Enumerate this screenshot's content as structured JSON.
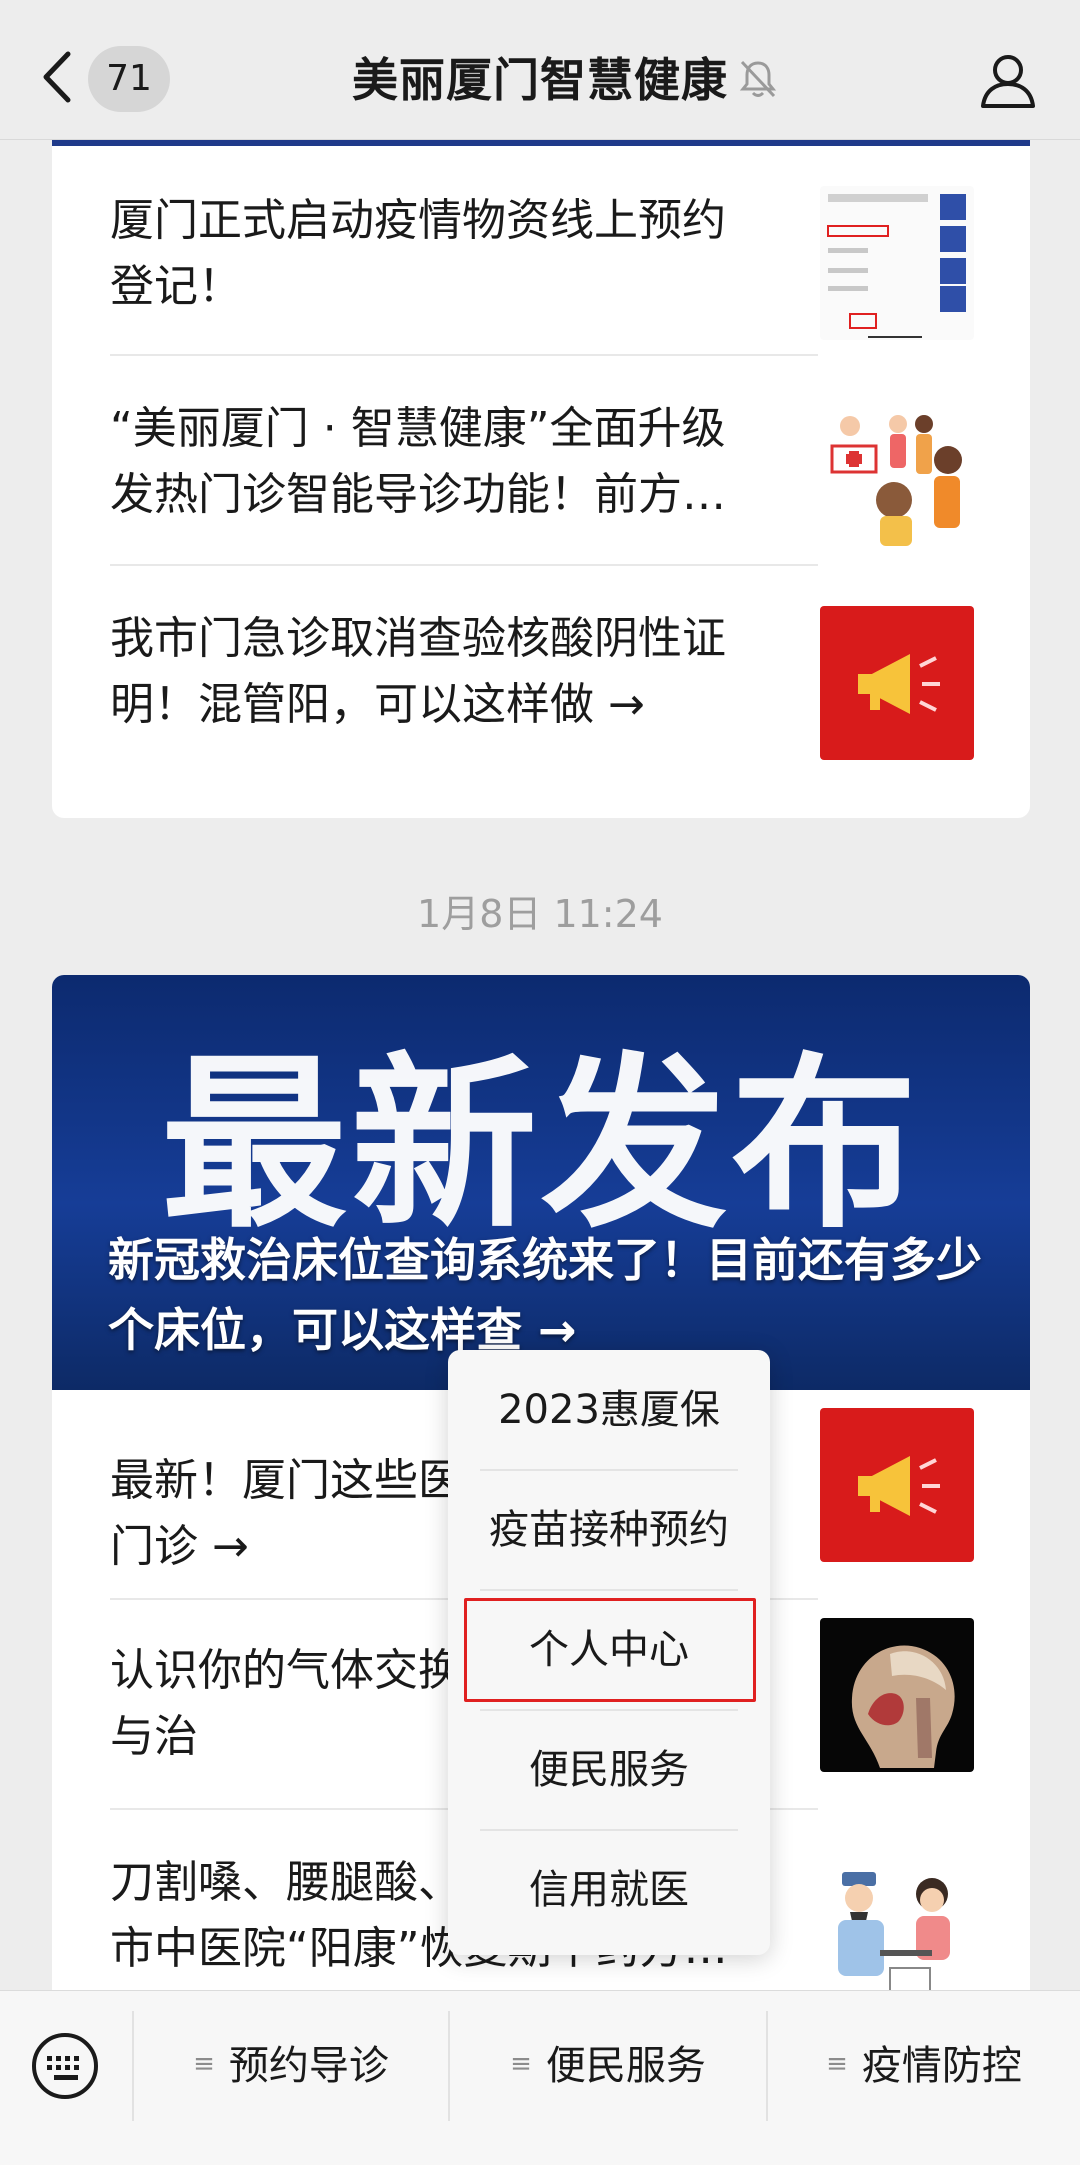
{
  "navbar": {
    "unread_count": "71",
    "title": "美丽厦门智慧健康"
  },
  "feed": {
    "group1": [
      {
        "title": "厦门正式启动疫情物资线上预约登记！",
        "thumb": "screenshot-thumbnail"
      },
      {
        "title": "“美丽厦门 · 智慧健康”全面升级发热门诊智能导诊功能！前方…",
        "thumb": "clinic-illustration"
      },
      {
        "title": "我市门急诊取消查验核酸阴性证明！混管阳，可以这样做 →",
        "thumb": "megaphone-thumbnail"
      }
    ],
    "timestamp": "1月8日 11:24",
    "group2": {
      "banner_word": "最新发布",
      "banner_caption": "新冠救治床位查询系统来了！目前还有多少个床位，可以这样查 →",
      "items": [
        {
          "title": "最新！厦门这些医…门诊 →",
          "line1": "最新！厦门这些医",
          "line2": "门诊 →",
          "thumb": "megaphone-thumbnail"
        },
        {
          "title": "认识你的气体交换…与治",
          "line1": "认识你的气体交换",
          "line2": "与治",
          "thumb": "xray-head-thumbnail"
        },
        {
          "title": "刀割嗓、腰腿酸、…市中医院“阳康”恢复期中药方…",
          "line1": "刀割嗓、腰腿酸、",
          "line2": "市中医院“阳康”恢复期中药方…",
          "thumb": "doctor-illustration"
        }
      ]
    }
  },
  "popup_menu": {
    "items": [
      "2023惠厦保",
      "疫苗接种预约",
      "个人中心",
      "便民服务",
      "信用就医"
    ],
    "highlighted_index": 2,
    "highlight_color": "#e02020"
  },
  "bottom_menu": {
    "items": [
      "预约导诊",
      "便民服务",
      "疫情防控"
    ]
  }
}
